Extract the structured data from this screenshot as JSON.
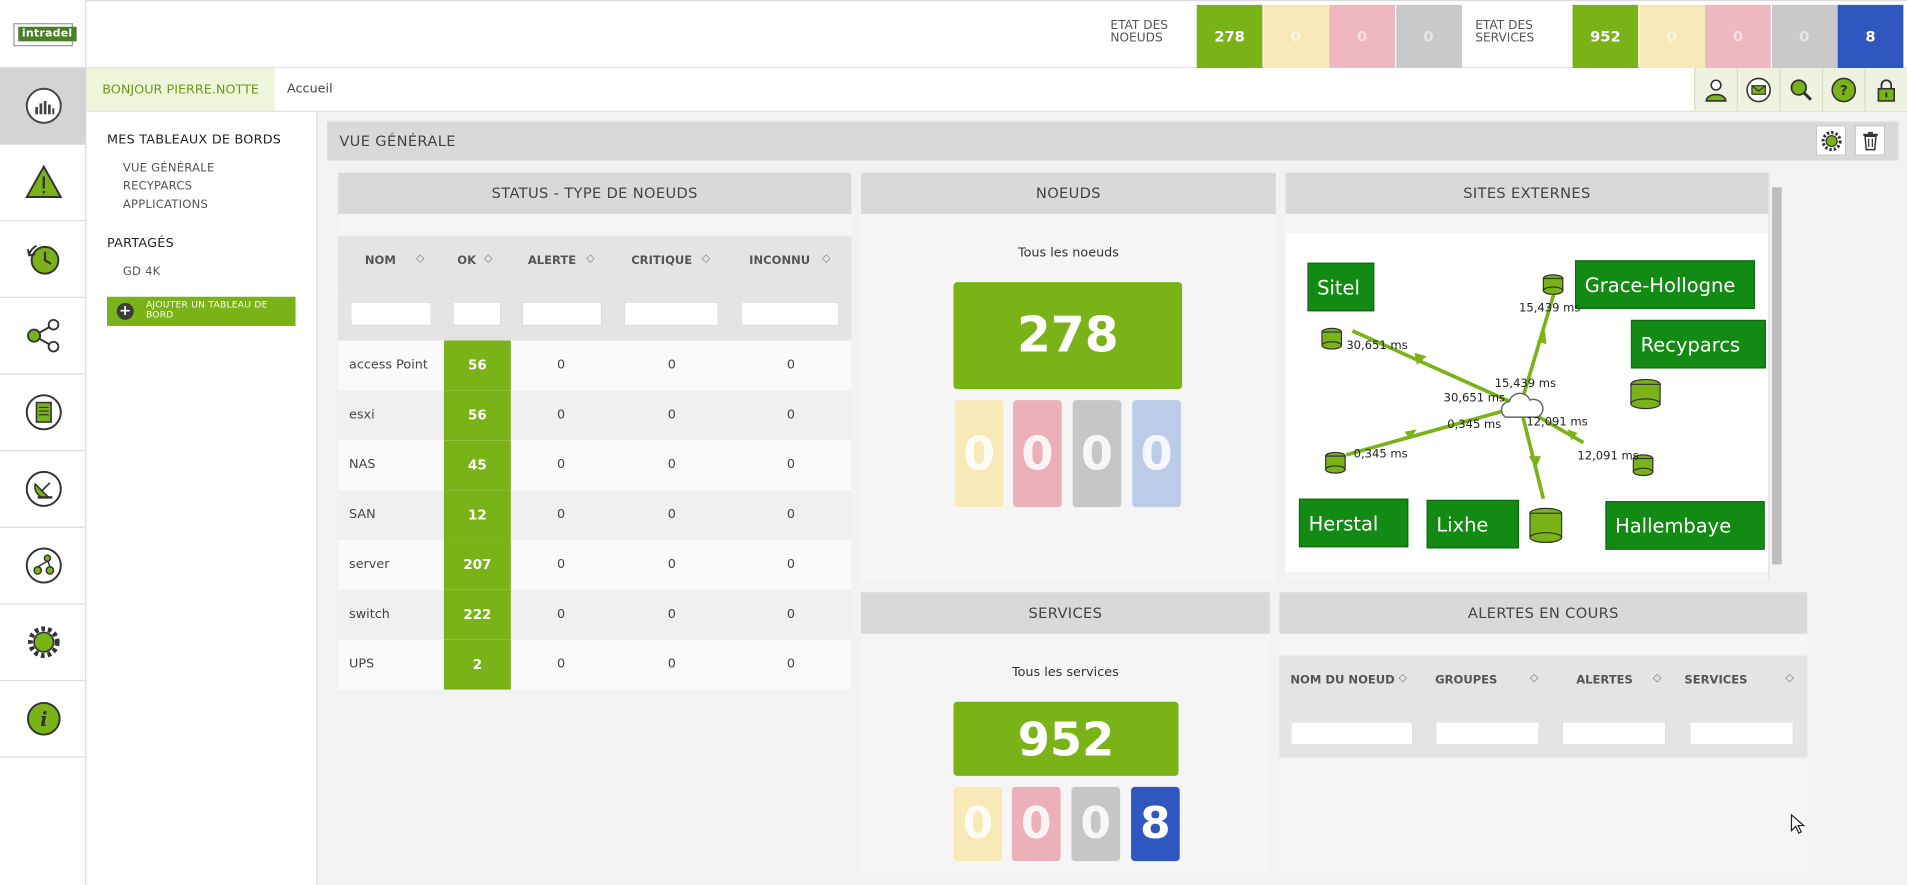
{
  "brand": {
    "logo_text": "intradel"
  },
  "header": {
    "nodes_label": "ETAT DES NOEUDS",
    "nodes_counts": [
      {
        "value": "278",
        "color": "#7ab317"
      },
      {
        "value": "0",
        "color": "#f7e9b8"
      },
      {
        "value": "0",
        "color": "#efb7c0"
      },
      {
        "value": "0",
        "color": "#c9c9c9"
      }
    ],
    "services_label": "ETAT DES SERVICES",
    "services_counts": [
      {
        "value": "952",
        "color": "#7ab317"
      },
      {
        "value": "0",
        "color": "#f7e9b8"
      },
      {
        "value": "0",
        "color": "#efb7c0"
      },
      {
        "value": "0",
        "color": "#c9c9c9"
      },
      {
        "value": "8",
        "color": "#3056c0"
      }
    ]
  },
  "subbar": {
    "greeting": "BONJOUR PIERRE.NOTTE",
    "breadcrumb": "Accueil",
    "tools": [
      "user-icon",
      "mail-icon",
      "search-icon",
      "help-icon",
      "lock-icon"
    ]
  },
  "rail": {
    "items": [
      "dashboard-icon",
      "alert-icon",
      "history-icon",
      "network-icon",
      "report-icon",
      "satellite-icon",
      "workflow-icon",
      "settings-icon",
      "info-icon"
    ]
  },
  "nav": {
    "section_mine": "MES TABLEAUX DE BORDS",
    "mine_items": [
      "VUE GÉNÉRALE",
      "RECYPARCS",
      "APPLICATIONS"
    ],
    "section_shared": "PARTAGÉS",
    "shared_items": [
      "GD 4K"
    ],
    "add_button": "AJOUTER UN TABLEAU DE BORD"
  },
  "main": {
    "title": "VUE GÉNÉRALE"
  },
  "status_panel": {
    "title": "STATUS - TYPE DE NOEUDS",
    "columns": [
      "NOM",
      "OK",
      "ALERTE",
      "CRITIQUE",
      "INCONNU"
    ],
    "rows": [
      {
        "name": "access Point",
        "ok": "56",
        "alerte": "0",
        "critique": "0",
        "inconnu": "0"
      },
      {
        "name": "esxi",
        "ok": "56",
        "alerte": "0",
        "critique": "0",
        "inconnu": "0"
      },
      {
        "name": "NAS",
        "ok": "45",
        "alerte": "0",
        "critique": "0",
        "inconnu": "0"
      },
      {
        "name": "SAN",
        "ok": "12",
        "alerte": "0",
        "critique": "0",
        "inconnu": "0"
      },
      {
        "name": "server",
        "ok": "207",
        "alerte": "0",
        "critique": "0",
        "inconnu": "0"
      },
      {
        "name": "switch",
        "ok": "222",
        "alerte": "0",
        "critique": "0",
        "inconnu": "0"
      },
      {
        "name": "UPS",
        "ok": "2",
        "alerte": "0",
        "critique": "0",
        "inconnu": "0"
      }
    ]
  },
  "nodes_panel": {
    "title": "NOEUDS",
    "subtitle": "Tous les noeuds",
    "total": "278",
    "minis": [
      {
        "value": "0",
        "color": "#f7e9b8"
      },
      {
        "value": "0",
        "color": "#ebb0ba"
      },
      {
        "value": "0",
        "color": "#c6c6c6"
      },
      {
        "value": "0",
        "color": "#bccbe8"
      }
    ]
  },
  "sites_panel": {
    "title": "SITES EXTERNES",
    "sites": [
      "Sitel",
      "Grace-Hollogne",
      "Recyparcs",
      "Herstal",
      "Lixhe",
      "Hallembaye"
    ],
    "latencies": [
      "15,439 ms",
      "30,651 ms",
      "15,439 ms",
      "30,651 ms",
      "0,345 ms",
      "12,091 ms",
      "0,345 ms",
      "12,091 ms"
    ]
  },
  "services_panel": {
    "title": "SERVICES",
    "subtitle": "Tous les services",
    "total": "952",
    "minis": [
      {
        "value": "0",
        "color": "#f7e9b8"
      },
      {
        "value": "0",
        "color": "#ebb0ba"
      },
      {
        "value": "0",
        "color": "#c6c6c6"
      },
      {
        "value": "8",
        "color": "#3056c0"
      }
    ]
  },
  "alerts_panel": {
    "title": "ALERTES EN COURS",
    "columns": [
      "NOM DU NOEUD",
      "GROUPES",
      "ALERTES",
      "SERVICES"
    ]
  }
}
